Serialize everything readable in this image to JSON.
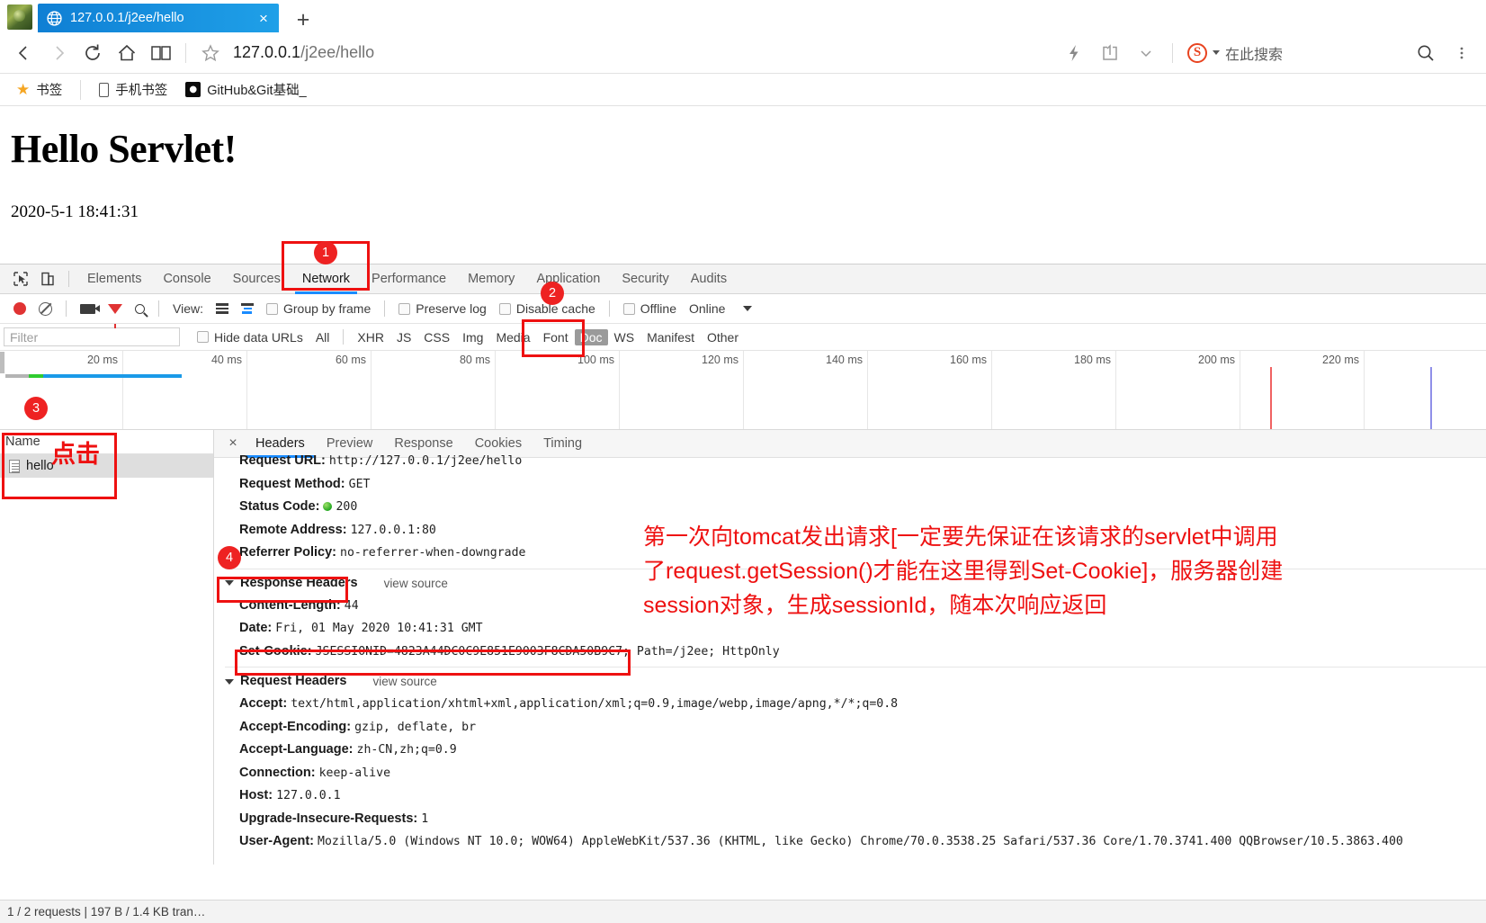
{
  "browser": {
    "tab": {
      "title": "127.0.0.1/j2ee/hello",
      "close_label": "×",
      "globe_icon": "globe-icon"
    },
    "newtab_label": "+",
    "nav": {
      "back_icon": "back-arrow-icon",
      "forward_icon": "forward-arrow-icon",
      "reload_icon": "reload-icon",
      "home_icon": "home-icon",
      "reading_icon": "reading-list-icon",
      "star_icon": "bookmark-star-icon",
      "url_host": "127.0.0.1",
      "url_path": "/j2ee/hello",
      "lightning_icon": "lightning-icon",
      "share_icon": "share-icon",
      "chevron_icon": "chevron-down-icon",
      "search_engine_letter": "S",
      "search_placeholder": "在此搜索",
      "search_icon": "search-icon"
    },
    "bookmarks": [
      {
        "label": "书签",
        "icon": "star-icon"
      },
      {
        "label": "手机书签",
        "icon": "phone-icon"
      },
      {
        "label": "GitHub&Git基础_",
        "icon": "github-icon"
      }
    ]
  },
  "page": {
    "heading": "Hello Servlet!",
    "timestamp": "2020-5-1 18:41:31"
  },
  "devtools": {
    "inspect_icon": "inspect-cursor-icon",
    "device_icon": "device-toolbar-icon",
    "tabs": [
      {
        "label": "Elements",
        "active": false
      },
      {
        "label": "Console",
        "active": false
      },
      {
        "label": "Sources",
        "active": false
      },
      {
        "label": "Network",
        "active": true
      },
      {
        "label": "Performance",
        "active": false
      },
      {
        "label": "Memory",
        "active": false
      },
      {
        "label": "Application",
        "active": false
      },
      {
        "label": "Security",
        "active": false
      },
      {
        "label": "Audits",
        "active": false
      }
    ],
    "toolbar": {
      "record_icon": "record-button-icon",
      "clear_icon": "clear-icon",
      "screenshot_icon": "camera-icon",
      "filter_icon": "funnel-icon",
      "search_icon": "search-icon",
      "view_label": "View:",
      "view_list_icon": "list-view-icon",
      "view_waterfall_icon": "waterfall-view-icon",
      "group_by_frame": "Group by frame",
      "preserve_log": "Preserve log",
      "disable_cache": "Disable cache",
      "offline": "Offline",
      "online": "Online",
      "throttle_caret_icon": "chevron-down-icon"
    },
    "filterbar": {
      "filter_placeholder": "Filter",
      "hide_data_urls": "Hide data URLs",
      "types": [
        {
          "label": "All",
          "active": false
        },
        {
          "label": "XHR",
          "active": false
        },
        {
          "label": "JS",
          "active": false
        },
        {
          "label": "CSS",
          "active": false
        },
        {
          "label": "Img",
          "active": false
        },
        {
          "label": "Media",
          "active": false
        },
        {
          "label": "Font",
          "active": false
        },
        {
          "label": "Doc",
          "active": true
        },
        {
          "label": "WS",
          "active": false
        },
        {
          "label": "Manifest",
          "active": false
        },
        {
          "label": "Other",
          "active": false
        }
      ]
    },
    "timeline": {
      "ticks": [
        "20 ms",
        "40 ms",
        "60 ms",
        "80 ms",
        "100 ms",
        "120 ms",
        "140 ms",
        "160 ms",
        "180 ms",
        "200 ms",
        "220 ms"
      ],
      "dom_content_loaded_color": "#f06262",
      "load_event_color": "#8f8fe8",
      "bar_wait_color": "#b4b4b4",
      "bar_connect_color": "#2fcc2f",
      "bar_download_color": "#1a9ae8"
    },
    "requests": {
      "column_name": "Name",
      "rows": [
        {
          "name": "hello",
          "icon": "document-icon"
        }
      ]
    },
    "detail": {
      "close_icon": "close-icon",
      "tabs": [
        {
          "label": "Headers",
          "active": true
        },
        {
          "label": "Preview",
          "active": false
        },
        {
          "label": "Response",
          "active": false
        },
        {
          "label": "Cookies",
          "active": false
        },
        {
          "label": "Timing",
          "active": false
        }
      ],
      "general": [
        {
          "key": "Request URL:",
          "value": "http://127.0.0.1/j2ee/hello"
        },
        {
          "key": "Request Method:",
          "value": "GET"
        },
        {
          "key": "Status Code:",
          "value": "200",
          "status": true
        },
        {
          "key": "Remote Address:",
          "value": "127.0.0.1:80"
        },
        {
          "key": "Referrer Policy:",
          "value": "no-referrer-when-downgrade"
        }
      ],
      "response_headers_title": "Response Headers",
      "view_source_label": "view source",
      "response_headers": [
        {
          "key": "Content-Length:",
          "value": "44"
        },
        {
          "key": "Date:",
          "value": "Fri, 01 May 2020 10:41:31 GMT"
        },
        {
          "key": "Set-Cookie:",
          "value": "JSESSIONID=4823A44DC0C9E851E9003F8CDA50B9C7; Path=/j2ee; HttpOnly"
        }
      ],
      "request_headers_title": "Request Headers",
      "request_headers": [
        {
          "key": "Accept:",
          "value": "text/html,application/xhtml+xml,application/xml;q=0.9,image/webp,image/apng,*/*;q=0.8"
        },
        {
          "key": "Accept-Encoding:",
          "value": "gzip, deflate, br"
        },
        {
          "key": "Accept-Language:",
          "value": "zh-CN,zh;q=0.9"
        },
        {
          "key": "Connection:",
          "value": "keep-alive"
        },
        {
          "key": "Host:",
          "value": "127.0.0.1"
        },
        {
          "key": "Upgrade-Insecure-Requests:",
          "value": "1"
        },
        {
          "key": "User-Agent:",
          "value": "Mozilla/5.0 (Windows NT 10.0; WOW64) AppleWebKit/537.36 (KHTML, like Gecko) Chrome/70.0.3538.25 Safari/537.36 Core/1.70.3741.400 QQBrowser/10.5.3863.400"
        }
      ]
    },
    "statusbar": "1 / 2 requests  |  197 B / 1.4 KB tran…"
  },
  "annotations": {
    "color": "#ee1111",
    "numbers": [
      "1",
      "2",
      "3",
      "4"
    ],
    "click_label": "点击",
    "note_lines": [
      "第一次向tomcat发出请求[一定要先保证在该请求的servlet中调用",
      "了request.getSession()才能在这里得到Set-Cookie]，服务器创建",
      "session对象，生成sessionId，随本次响应返回"
    ]
  }
}
